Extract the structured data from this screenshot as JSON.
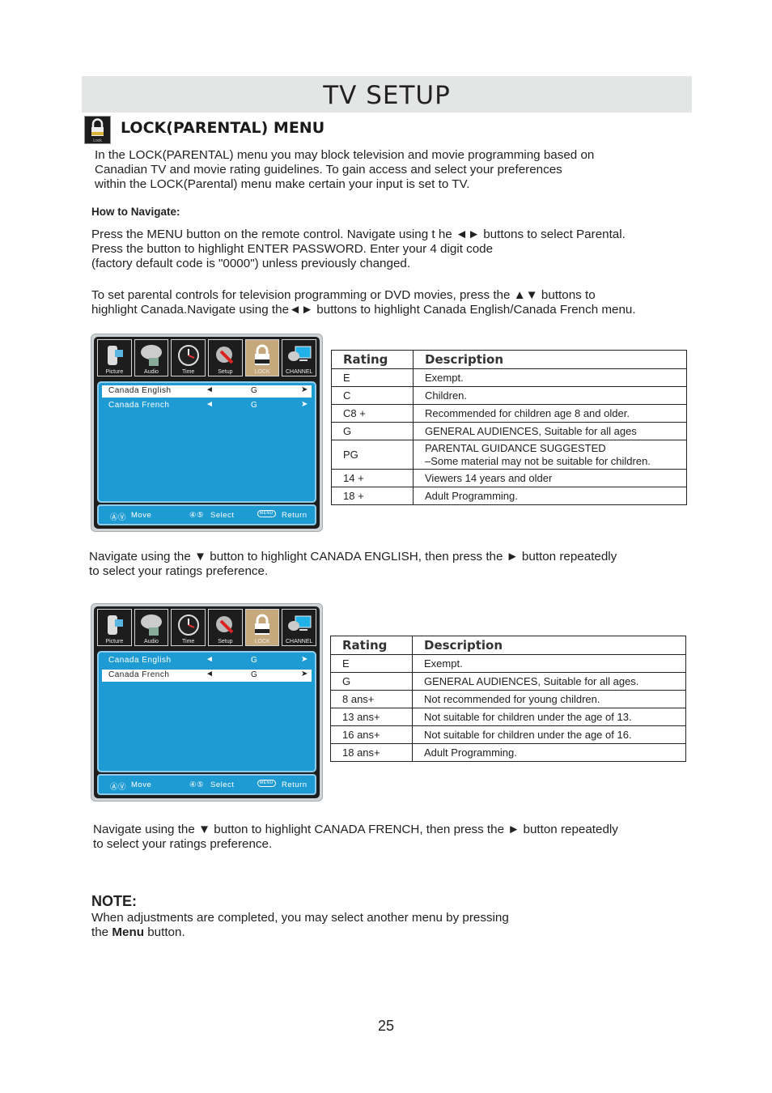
{
  "header": {
    "title": "TV SETUP"
  },
  "section": {
    "icon": "lock-icon",
    "icon_label": "Lock",
    "title": "LOCK(PARENTAL) MENU"
  },
  "intro": "In the LOCK(PARENTAL) menu you may block television and movie programming based on\nCanadian TV and movie rating guidelines. To gain access and select your preferences\nwithin the LOCK(Parental) menu make certain your input is set to TV.",
  "how_to": {
    "heading": "How to Navigate:",
    "step1": "Press the MENU button on the remote control. Navigate using t he ◄► buttons to select Parental.\nPress the button to highlight ENTER PASSWORD. Enter your 4 digit code\n(factory default code is \"0000\") unless previously changed.",
    "step2": "To set parental controls for television programming or DVD movies, press the ▲▼ buttons to\nhighlight Canada.Navigate using the◄► buttons to highlight Canada English/Canada French menu."
  },
  "tv_menu": {
    "tabs": [
      {
        "label": "Picture",
        "icon": "camcorder-icon"
      },
      {
        "label": "Audio",
        "icon": "speaker-icon"
      },
      {
        "label": "Time",
        "icon": "clock-icon"
      },
      {
        "label": "Setup",
        "icon": "gear-wrench-icon"
      },
      {
        "label": "LOCK",
        "icon": "padlock-icon"
      },
      {
        "label": "CHANNEL",
        "icon": "satellite-monitor-icon"
      }
    ],
    "rows": [
      {
        "name": "Canada English",
        "value": "G",
        "left": "◄",
        "right": "➤"
      },
      {
        "name": "Canada French",
        "value": "G",
        "left": "◄",
        "right": "➤"
      }
    ],
    "footer": {
      "move": "Move",
      "select": "Select",
      "menu_badge": "MENU",
      "return": "Return",
      "move_icon": "ⒶⓋ",
      "select_icon": "④⑤"
    }
  },
  "table_english": {
    "headers": [
      "Rating",
      "Description"
    ],
    "rows": [
      [
        "E",
        "Exempt."
      ],
      [
        "C",
        "Children."
      ],
      [
        "C8 +",
        "Recommended  for  children  age  8  and  older."
      ],
      [
        "G",
        "GENERAL AUDIENCES, Suitable for all ages"
      ],
      [
        "PG",
        "PARENTAL GUIDANCE SUGGESTED\n–Some material may not be suitable for children."
      ],
      [
        "14 +",
        "Viewers 14 years and older"
      ],
      [
        "18 +",
        "Adult Programming."
      ]
    ]
  },
  "caption_english": "Navigate using the ▼ button to highlight CANADA ENGLISH, then press the ► button repeatedly\nto select your ratings preference.",
  "table_french": {
    "headers": [
      "Rating",
      "Description"
    ],
    "rows": [
      [
        "E",
        "Exempt."
      ],
      [
        "G",
        "GENERAL AUDIENCES, Suitable for all ages."
      ],
      [
        "8 ans+",
        "Not  recommended  for  young  children."
      ],
      [
        "13 ans+",
        "Not suitable for children under the age of 13."
      ],
      [
        "16 ans+",
        "Not suitable for children under the age of 16."
      ],
      [
        "18 ans+",
        "Adult Programming."
      ]
    ]
  },
  "caption_french": "Navigate using the ▼ button to highlight CANADA FRENCH, then press the ► button repeatedly\nto select your ratings preference.",
  "note": {
    "heading": "NOTE:",
    "text_before": "When adjustments are completed, you may select another menu by pressing\nthe ",
    "bold": "Menu",
    "text_after": " button."
  },
  "page_number": "25"
}
